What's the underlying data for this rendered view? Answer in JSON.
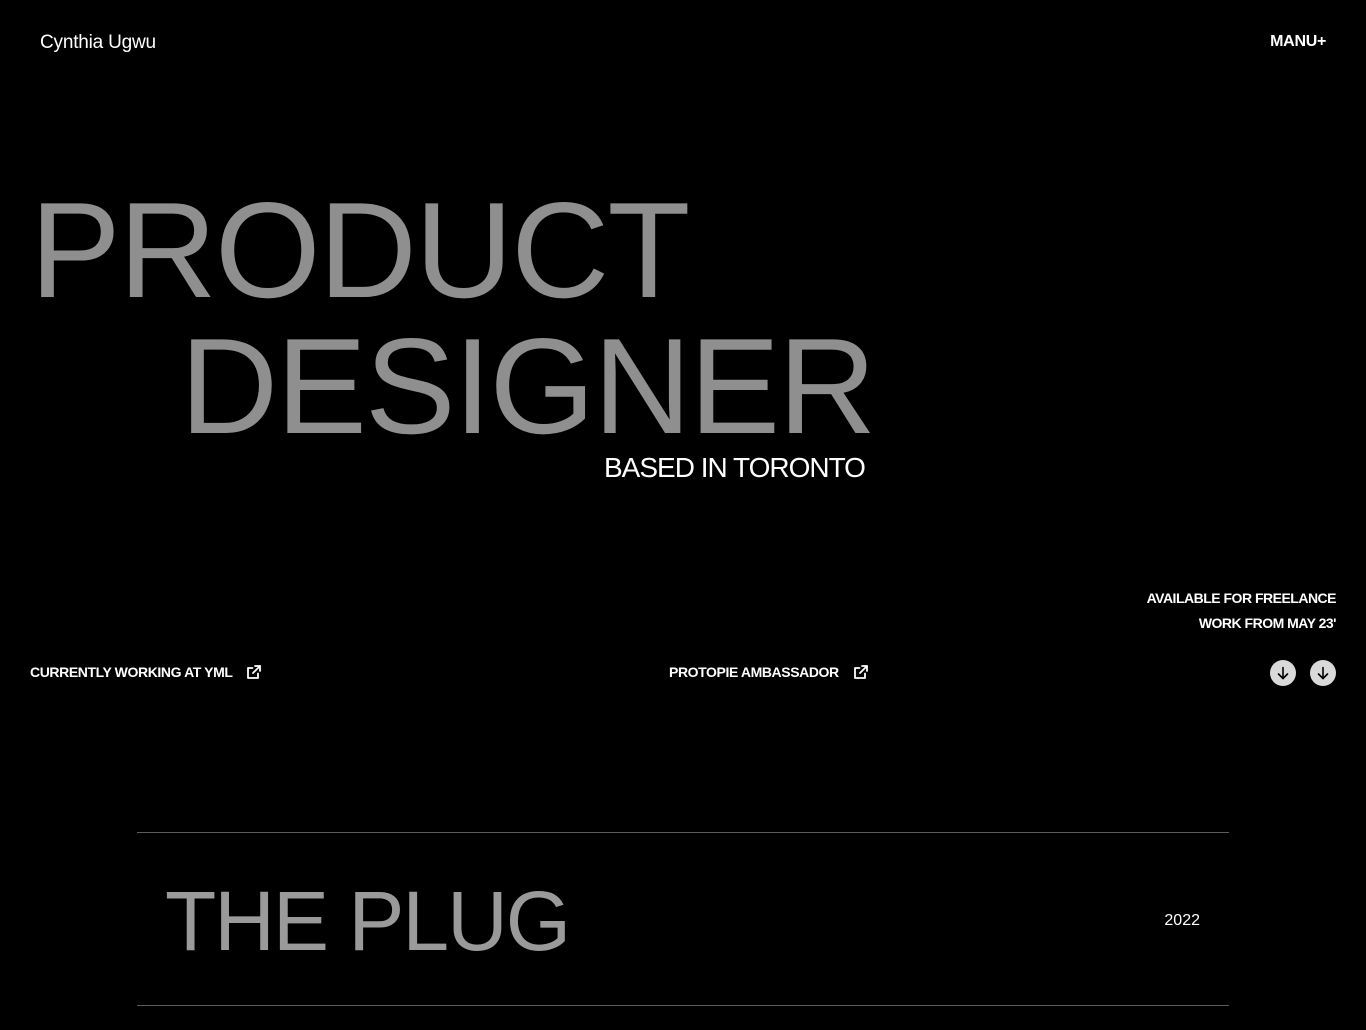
{
  "header": {
    "brand": "Cynthia Ugwu",
    "menu_label": "MANU+"
  },
  "hero": {
    "line1": "PRODUCT",
    "line2": "DESIGNER",
    "location": "BASED IN TORONTO"
  },
  "availability": {
    "line1": "AVAILABLE FOR FREELANCE",
    "line2": "WORK FROM MAY 23'"
  },
  "links": {
    "current_job": "CURRENTLY WORKING AT YML",
    "ambassador": "PROTOPIE AMBASSADOR"
  },
  "icons": {
    "external": "external-link-icon",
    "scroll": "arrow-down-icon"
  },
  "projects": [
    {
      "title": "THE PLUG",
      "year": "2022"
    }
  ],
  "colors": {
    "background": "#000000",
    "hero_text": "#8f8f8f",
    "text": "#ffffff",
    "button": "#d9d9d9",
    "divider": "#5c5c5c"
  }
}
